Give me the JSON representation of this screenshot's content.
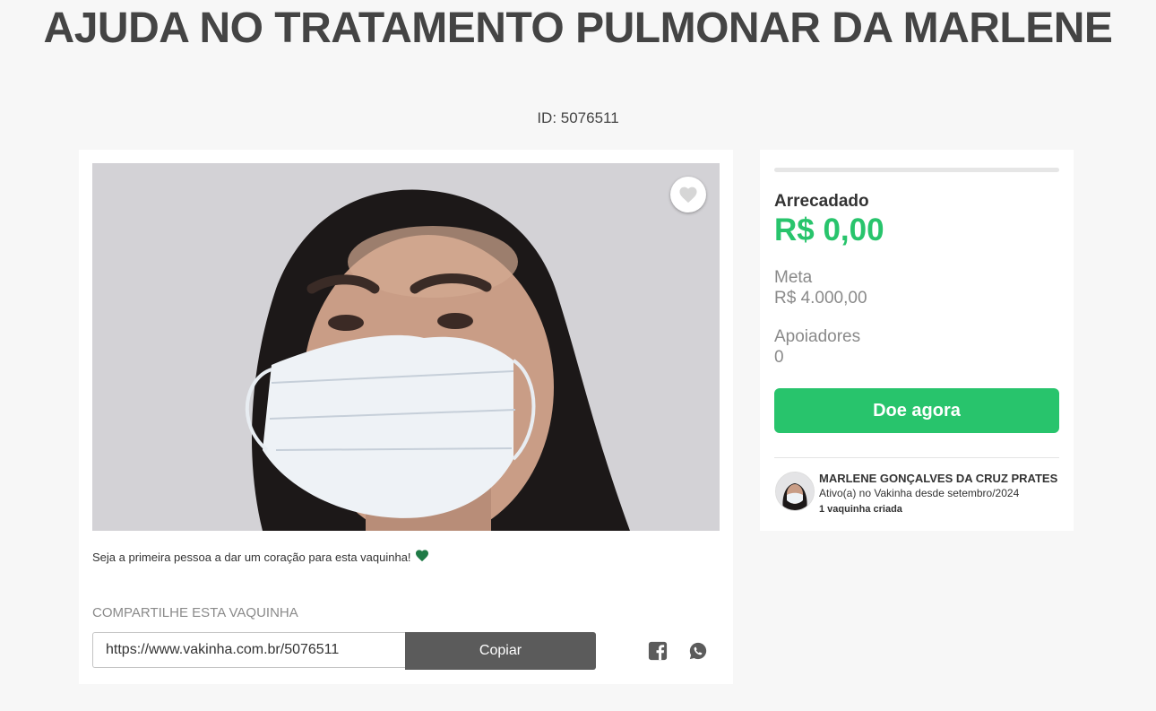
{
  "header": {
    "title": "AJUDA NO TRATAMENTO PULMONAR DA MARLENE",
    "id_label": "ID: 5076511"
  },
  "campaign": {
    "photo_alt": "Foto da campanha",
    "favorite_icon": "heart-icon",
    "hearts_message": "Seja a primeira pessoa a dar um coração para esta vaquinha!",
    "hearts_icon": "green-heart-icon",
    "share": {
      "title": "COMPARTILHE ESTA VAQUINHA",
      "url": "https://www.vakinha.com.br/5076511",
      "copy_label": "Copiar",
      "icons": [
        "facebook-icon",
        "whatsapp-icon"
      ]
    }
  },
  "sidebar": {
    "progress_fraction": 0,
    "raised_label": "Arrecadado",
    "raised_value": "R$ 0,00",
    "goal_label": "Meta",
    "goal_value": "R$ 4.000,00",
    "supporters_label": "Apoiadores",
    "supporters_value": "0",
    "donate_label": "Doe agora",
    "organizer": {
      "name": "MARLENE GONÇALVES DA CRUZ PRATES",
      "since": "Ativo(a) no Vakinha desde setembro/2024",
      "count": "1 vaquinha criada"
    }
  },
  "colors": {
    "accent_green": "#28c46c",
    "dark_green_heart": "#1f7a46",
    "copy_button": "#5b5b5b",
    "background": "#f7f7f7"
  }
}
